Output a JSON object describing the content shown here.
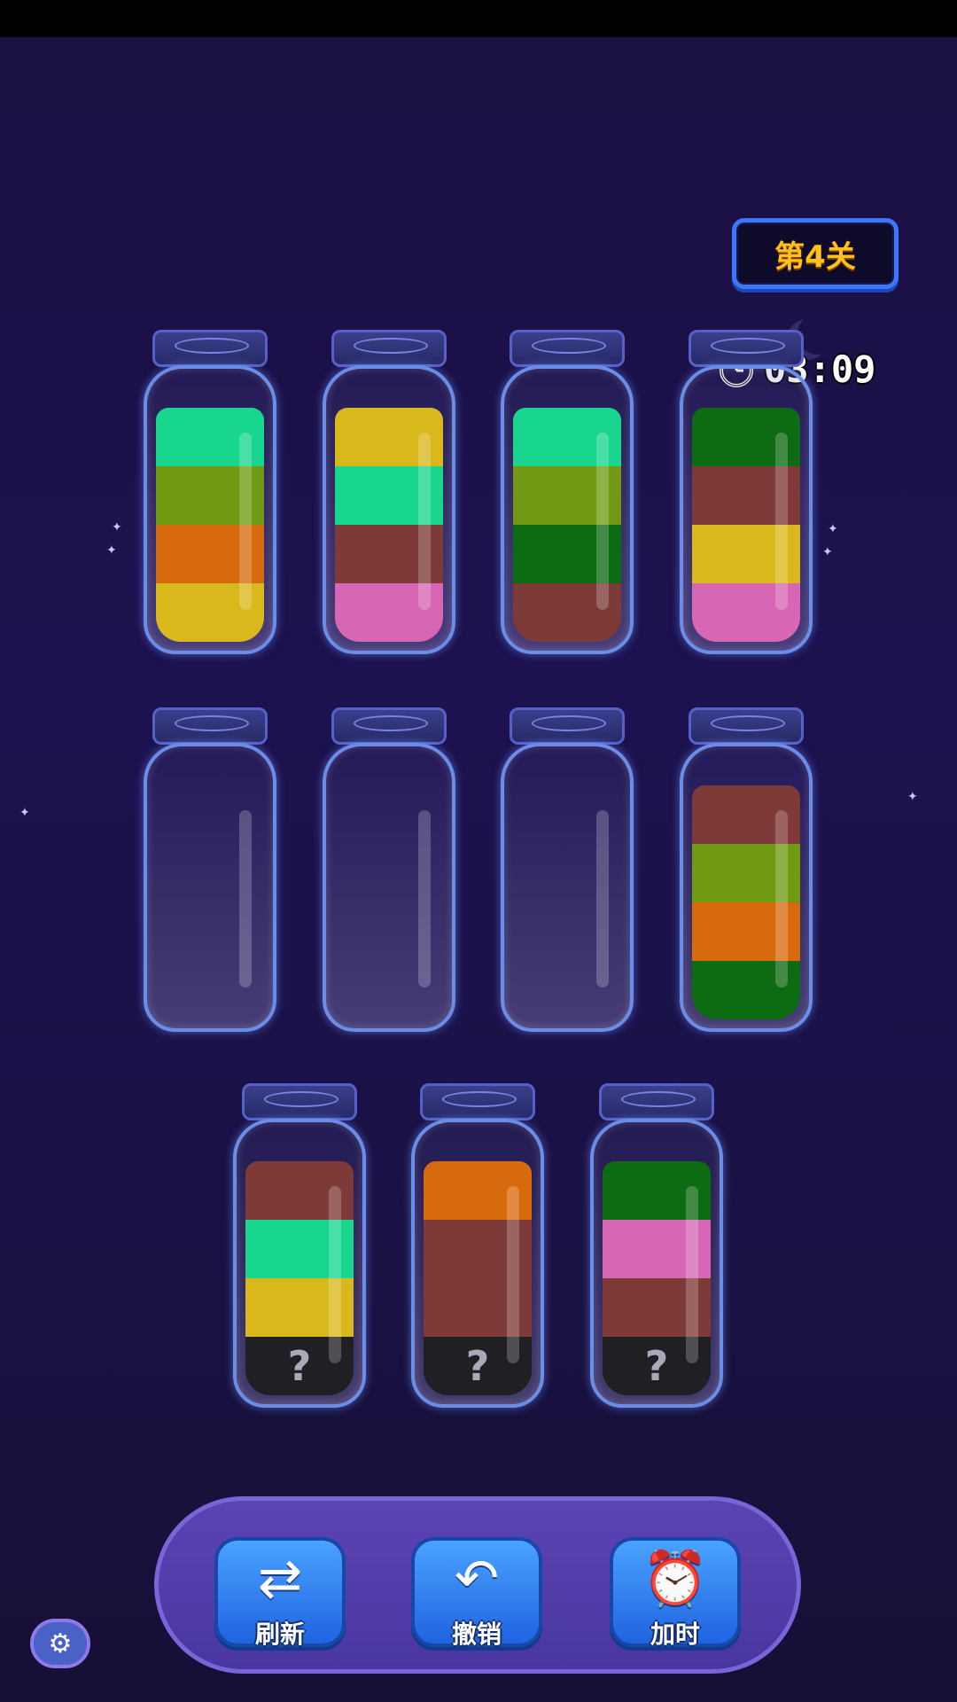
{
  "level": {
    "label": "第4关"
  },
  "timer": {
    "value": "03:09",
    "icon": "alarm-clock-icon"
  },
  "colors": {
    "mint": "#19d68f",
    "olive": "#6f9a11",
    "orange": "#d86a0e",
    "yellow": "#d9b81b",
    "pink": "#d767b4",
    "brown": "#7d3a36",
    "darkgreen": "#0d6b12",
    "hidden": "#1f1f24"
  },
  "bottles": [
    {
      "layers": [
        "yellow",
        "orange",
        "olive",
        "mint"
      ]
    },
    {
      "layers": [
        "pink",
        "brown",
        "mint",
        "yellow"
      ]
    },
    {
      "layers": [
        "brown",
        "darkgreen",
        "olive",
        "mint"
      ]
    },
    {
      "layers": [
        "pink",
        "yellow",
        "brown",
        "darkgreen"
      ]
    },
    {
      "layers": []
    },
    {
      "layers": []
    },
    {
      "layers": []
    },
    {
      "layers": [
        "darkgreen",
        "orange",
        "olive",
        "brown"
      ]
    },
    {
      "layers": [
        "hidden",
        "yellow",
        "mint",
        "brown"
      ]
    },
    {
      "layers": [
        "hidden",
        "brown",
        "brown",
        "orange"
      ]
    },
    {
      "layers": [
        "hidden",
        "brown",
        "pink",
        "darkgreen"
      ]
    }
  ],
  "hidden_mark": "?",
  "toolbar": {
    "refresh_label": "刷新",
    "undo_label": "撤销",
    "add_time_label": "加时"
  },
  "settings": {
    "icon": "gear-icon"
  }
}
